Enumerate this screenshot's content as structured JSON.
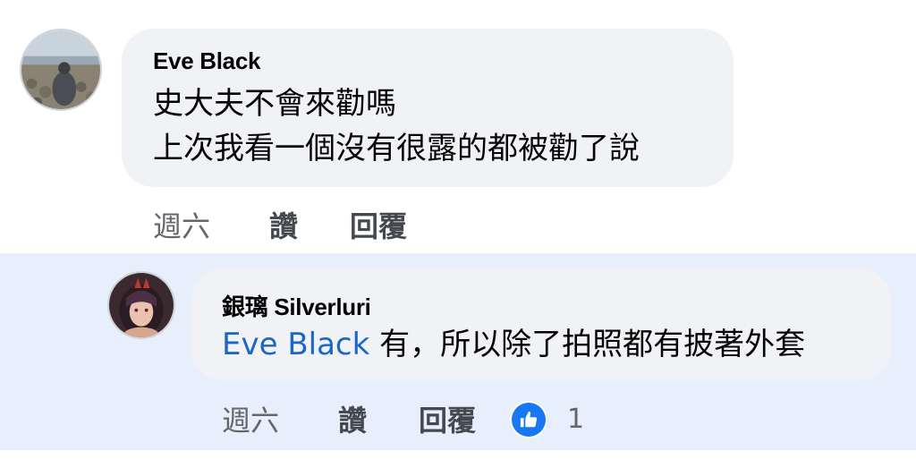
{
  "comments": [
    {
      "author": "Eve Black",
      "lines": [
        "史大夫不會來勸嗎",
        "上次我看一個沒有很露的都被勸了說"
      ],
      "time": "週六",
      "like_label": "讚",
      "reply_label": "回覆"
    },
    {
      "author": "銀璃 Silverluri",
      "mention": "Eve Black",
      "text": " 有，所以除了拍照都有披著外套",
      "time": "週六",
      "like_label": "讚",
      "reply_label": "回覆",
      "reaction_icon": "thumbs-up-icon",
      "reaction_count": "1"
    }
  ],
  "colors": {
    "reply_highlight": "#e7effc",
    "bubble": "#f0f2f5",
    "mention": "#1b66c9",
    "like": "#1877f2"
  }
}
